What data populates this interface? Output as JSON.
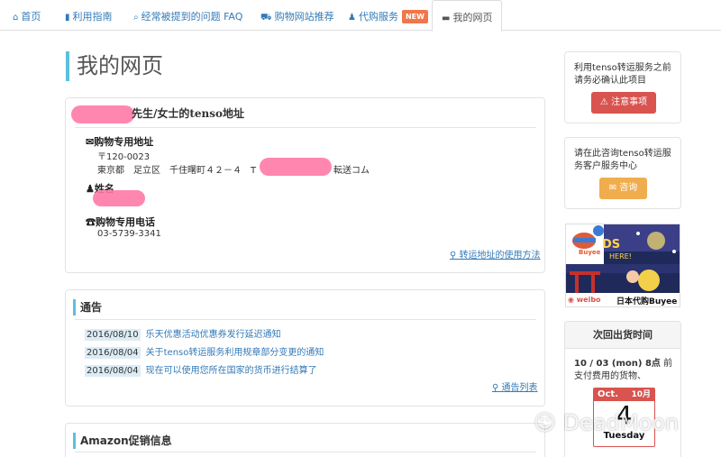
{
  "nav": {
    "items": [
      {
        "icon": "home-icon",
        "glyph": "⌂",
        "label": "首页"
      },
      {
        "icon": "book-icon",
        "glyph": "▮",
        "label": "利用指南"
      },
      {
        "icon": "search-icon",
        "glyph": "⌕",
        "label": "经常被提到的问题 FAQ"
      },
      {
        "icon": "cart-icon",
        "glyph": "⛟",
        "label": "购物网站推荐"
      },
      {
        "icon": "person-icon",
        "glyph": "♟",
        "label": "代购服务",
        "badge": "NEW"
      },
      {
        "icon": "window-icon",
        "glyph": "▬",
        "label": "我的网页"
      }
    ]
  },
  "page": {
    "title": "我的网页"
  },
  "address": {
    "title": "先生/女士的tenso地址",
    "shipping_label": "购物专用地址",
    "postal": "〒120-0023",
    "line_prefix": "東京都　足立区　千住曙町４２－４　T",
    "line_suffix": "転送コム",
    "name_label": "姓名",
    "phone_label": "购物专用电话",
    "phone": "03-5739-3341",
    "howto_link": "转运地址的使用方法"
  },
  "notice": {
    "title": "通告",
    "items": [
      {
        "date": "2016/08/10",
        "text": "乐天优惠活动优惠券发行延迟通知"
      },
      {
        "date": "2016/08/04",
        "text": "关于tenso转运服务利用规章部分变更的通知"
      },
      {
        "date": "2016/08/04",
        "text": "现在可以使用您所在国家的货币进行结算了"
      }
    ],
    "list_link": "通告列表"
  },
  "amazon": {
    "title": "Amazon促销信息"
  },
  "sidebar": {
    "confirm_text": "利用tenso转运服务之前请务必确认此项目",
    "notes_button": "注意事项",
    "consult_text": "请在此咨询tenso转运服务客户服务中心",
    "consult_button": "咨询",
    "banner": {
      "brand": "Buyee",
      "caption": "日本代购Buyee",
      "weibo": "weibo"
    },
    "shipping": {
      "title": "次回出货时间",
      "date_bold": "10 / 03 (mon) 8点",
      "date_rest": " 前支付费用的货物、",
      "cal_month": "Oct.",
      "cal_month_num": "10月",
      "cal_day": "4",
      "cal_weekday": "Tuesday"
    }
  },
  "watermark": "DeadMoon",
  "colors": {
    "accent": "#5bc0de",
    "link": "#337ab7",
    "danger": "#d9534f",
    "warning": "#f0ad4e",
    "badge": "#f0774b"
  }
}
